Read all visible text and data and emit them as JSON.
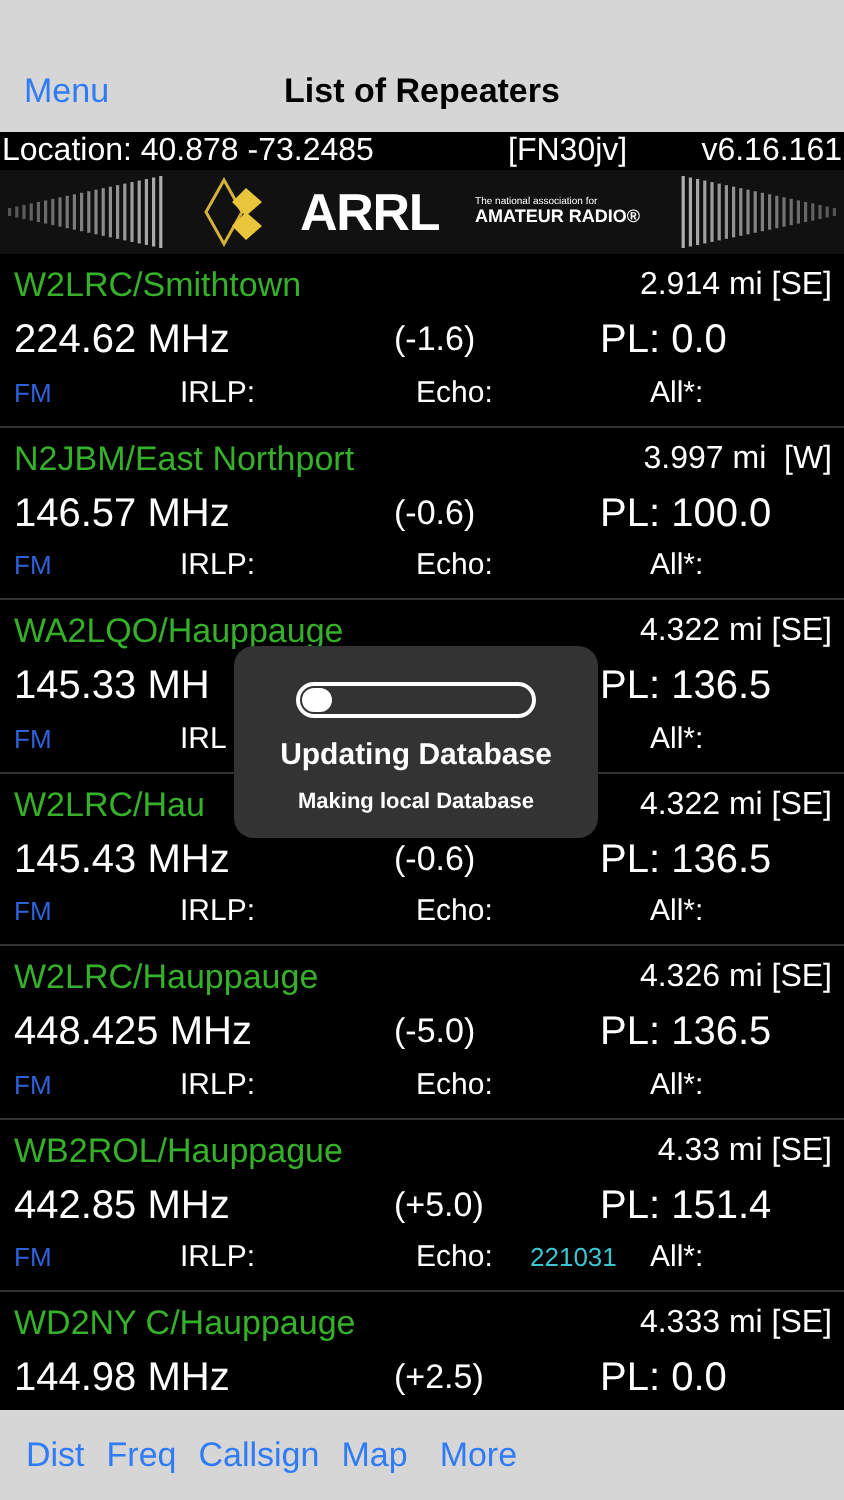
{
  "nav": {
    "menu": "Menu",
    "title": "List of Repeaters"
  },
  "info_bar": {
    "location": "Location: 40.878 -73.2485",
    "grid": "[FN30jv]",
    "version": "v6.16.161"
  },
  "banner": {
    "logo": "ARRL",
    "tagline_top": "The national association for",
    "tagline_bottom": "AMATEUR RADIO®"
  },
  "repeaters": [
    {
      "name": "W2LRC/Smithtown",
      "distance": "2.914 mi [SE]",
      "freq": "224.62 MHz",
      "offset": "(-1.6)",
      "pl": "PL: 0.0",
      "mode": "FM",
      "irlp": "IRLP:",
      "echo": "Echo:",
      "all": "All*:"
    },
    {
      "name": "N2JBM/East Northport",
      "distance": "3.997 mi  [W]",
      "freq": "146.57 MHz",
      "offset": "(-0.6)",
      "pl": "PL: 100.0",
      "mode": "FM",
      "irlp": "IRLP:",
      "echo": "Echo:",
      "all": "All*:"
    },
    {
      "name": "WA2LQO/Hauppauge",
      "distance": "4.322 mi [SE]",
      "freq": "145.33 MH",
      "pl": "PL: 136.5",
      "mode": "FM",
      "irlp": "IRL",
      "all": "All*:"
    },
    {
      "name": "W2LRC/Hau",
      "distance": "4.322 mi [SE]",
      "freq": "145.43 MHz",
      "offset": "(-0.6)",
      "pl": "PL: 136.5",
      "mode": "FM",
      "irlp": "IRLP:",
      "echo": "Echo:",
      "all": "All*:"
    },
    {
      "name": "W2LRC/Hauppauge",
      "distance": "4.326 mi [SE]",
      "freq": "448.425 MHz",
      "offset": "(-5.0)",
      "pl": "PL: 136.5",
      "mode": "FM",
      "irlp": "IRLP:",
      "echo": "Echo:",
      "all": "All*:"
    },
    {
      "name": "WB2ROL/Hauppague",
      "distance": "4.33 mi [SE]",
      "freq": "442.85 MHz",
      "offset": "(+5.0)",
      "pl": "PL: 151.4",
      "mode": "FM",
      "irlp": "IRLP:",
      "echo": "Echo:",
      "echo_node": "221031",
      "all": "All*:"
    },
    {
      "name": "WD2NY  C/Hauppauge",
      "distance": "4.333 mi [SE]",
      "freq": "144.98 MHz",
      "offset": "(+2.5)",
      "pl": "PL: 0.0"
    }
  ],
  "progress_dialog": {
    "level": 0.13,
    "title": "Updating Database",
    "message": "Making local Database"
  },
  "toolbar": [
    "Dist",
    "Freq",
    "Callsign",
    "Map",
    "More"
  ]
}
